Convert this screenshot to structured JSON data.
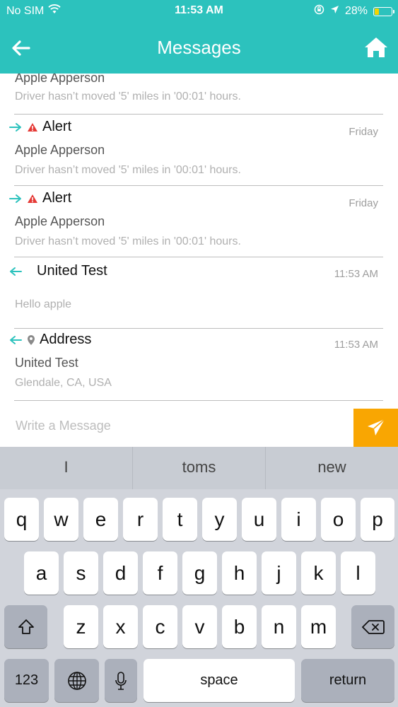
{
  "status_bar": {
    "carrier": "No SIM",
    "time": "11:53 AM",
    "battery": "28%",
    "battery_level": 0.28
  },
  "header": {
    "title": "Messages",
    "back_icon": "arrow-left-icon",
    "home_icon": "home-icon"
  },
  "messages": [
    {
      "direction": "outgoing",
      "type": "alert",
      "title": "",
      "time": "",
      "sender": "Apple Apperson",
      "body": "Driver hasn’t moved '5' miles in '00:01' hours."
    },
    {
      "direction": "outgoing",
      "type": "alert",
      "title": "Alert",
      "time": "Friday",
      "sender": "Apple Apperson",
      "body": "Driver hasn’t moved '5' miles in '00:01' hours."
    },
    {
      "direction": "outgoing",
      "type": "alert",
      "title": "Alert",
      "time": "Friday",
      "sender": "Apple Apperson",
      "body": "Driver hasn’t moved '5' miles in '00:01' hours."
    },
    {
      "direction": "incoming",
      "type": "text",
      "title": "United Test",
      "time": "11:53 AM",
      "sender": "",
      "body": "Hello apple"
    },
    {
      "direction": "incoming",
      "type": "address",
      "title": "Address",
      "time": "11:53 AM",
      "sender": "United Test",
      "body": "Glendale, CA, USA"
    }
  ],
  "composer": {
    "placeholder": "Write a Message",
    "send_icon": "paper-plane-icon"
  },
  "keyboard": {
    "suggestions": [
      "I",
      "toms",
      "new"
    ],
    "row1": [
      "q",
      "w",
      "e",
      "r",
      "t",
      "y",
      "u",
      "i",
      "o",
      "p"
    ],
    "row2": [
      "a",
      "s",
      "d",
      "f",
      "g",
      "h",
      "j",
      "k",
      "l"
    ],
    "row3": [
      "z",
      "x",
      "c",
      "v",
      "b",
      "n",
      "m"
    ],
    "numbers_label": "123",
    "space_label": "space",
    "return_label": "return"
  }
}
